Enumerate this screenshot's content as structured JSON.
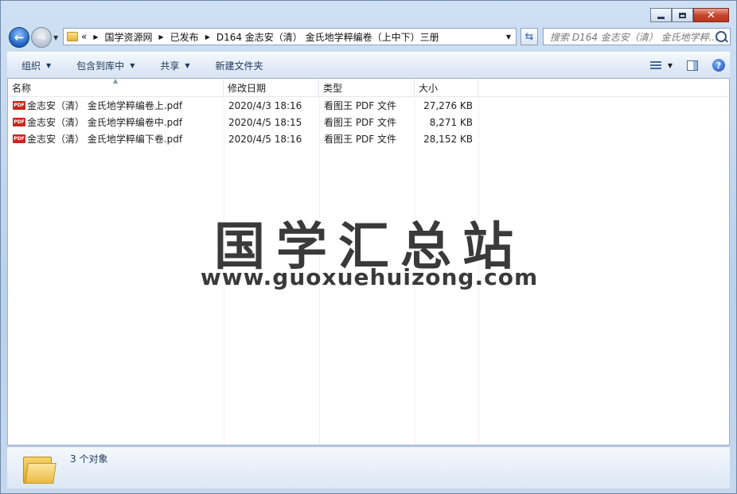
{
  "address": {
    "overflow": "«",
    "crumbs": [
      "国学资源网",
      "已发布",
      "D164 金志安（清） 金氏地学粹编卷（上中下）三册"
    ]
  },
  "search": {
    "placeholder": "搜索 D164 金志安（清） 金氏地学粹..."
  },
  "toolbar": {
    "organize": "组织",
    "include_library": "包含到库中",
    "share": "共享",
    "new_folder": "新建文件夹"
  },
  "columns": {
    "name": "名称",
    "modified": "修改日期",
    "type": "类型",
    "size": "大小"
  },
  "files": [
    {
      "icon": "pdf-icon",
      "name": "金志安（清） 金氏地学粹编卷上.pdf",
      "modified": "2020/4/3 18:16",
      "type": "看图王 PDF 文件",
      "size": "27,276 KB"
    },
    {
      "icon": "pdf-icon",
      "name": "金志安（清） 金氏地学粹编卷中.pdf",
      "modified": "2020/4/5 18:15",
      "type": "看图王 PDF 文件",
      "size": "8,271 KB"
    },
    {
      "icon": "pdf-icon",
      "name": "金志安（清） 金氏地学粹编下卷.pdf",
      "modified": "2020/4/5 18:16",
      "type": "看图王 PDF 文件",
      "size": "28,152 KB"
    }
  ],
  "watermark": {
    "title": "国学汇总站",
    "url": "www.guoxuehuizong.com"
  },
  "status": {
    "count": "3 个对象"
  },
  "colors": {
    "pdf": "#c52a1d",
    "toolbar_text": "#1e395b",
    "close": "#c7462d"
  }
}
